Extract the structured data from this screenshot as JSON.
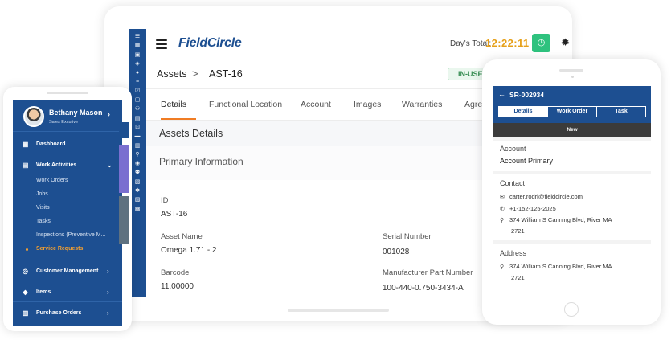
{
  "tablet": {
    "logo": "FieldCircle",
    "days_total_label": "Day's Total:",
    "days_total_value": "12:22:11",
    "clock_icon": "clock-icon",
    "breadcrumb": {
      "parent": "Assets",
      "separator": ">",
      "current": "AST-16"
    },
    "status_badge": "IN-USE",
    "tabs": [
      "Details",
      "Functional Location",
      "Account",
      "Images",
      "Warranties",
      "Agree"
    ],
    "section_title": "Assets Details",
    "subsection_title": "Primary Information",
    "fields": {
      "id": {
        "label": "ID",
        "value": "AST-16"
      },
      "asset_name": {
        "label": "Asset Name",
        "value": "Omega 1.71 - 2"
      },
      "serial_number": {
        "label": "Serial Number",
        "value": "001028"
      },
      "barcode": {
        "label": "Barcode",
        "value": "11.00000"
      },
      "mfr_part_number": {
        "label": "Manufacturer Part Number",
        "value": "100-440-0.750-3434-A"
      }
    },
    "accent_color": "#f07c24",
    "brand_color": "#1d4f91"
  },
  "left_phone": {
    "user_name": "Bethany Mason",
    "user_role": "Sales Excutive",
    "nav": {
      "dashboard": "Dashboard",
      "work_activities": "Work Activities",
      "sub_items": [
        "Work Orders",
        "Jobs",
        "Visits",
        "Tasks",
        "Inspections (Preventive M...",
        "Service Requests"
      ],
      "customer_management": "Customer Management",
      "items": "Items",
      "purchase_orders": "Purchase Orders"
    },
    "active_color": "#f5a030"
  },
  "right_phone": {
    "title": "SR-002934",
    "segments": [
      "Details",
      "Work Order",
      "Task"
    ],
    "status": "New",
    "account": {
      "label": "Account",
      "value": "Account Primary"
    },
    "contact": {
      "label": "Contact",
      "email": "carter.rodri@fieldcircle.com",
      "phone": "+1-152-125-2025",
      "address_line1": "374 William S Canning Blvd, River MA",
      "address_line2": "2721"
    },
    "address": {
      "label": "Address",
      "line1": "374 William S Canning Blvd, River MA",
      "line2": "2721"
    }
  }
}
